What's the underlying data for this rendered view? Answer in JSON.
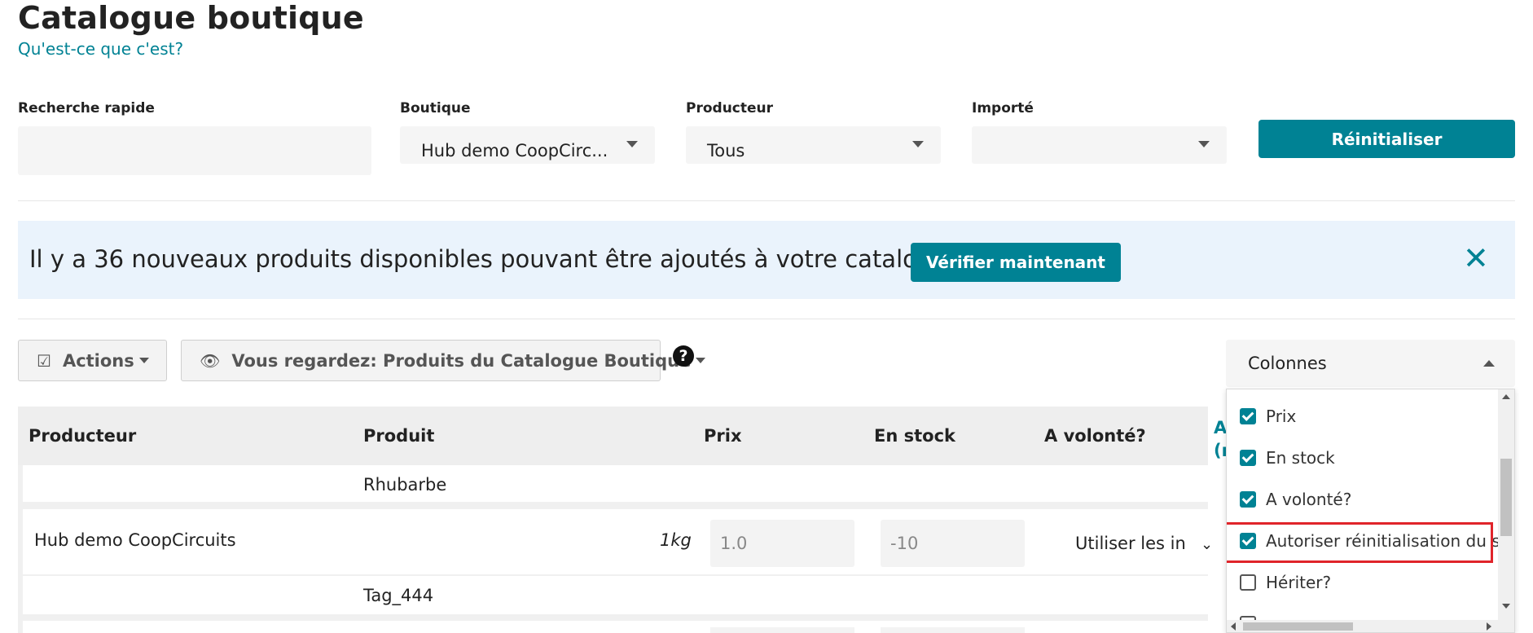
{
  "page": {
    "title": "Catalogue boutique",
    "help_link": "Qu'est-ce que c'est?"
  },
  "filters": {
    "quick_search": {
      "label": "Recherche rapide",
      "value": ""
    },
    "shop": {
      "label": "Boutique",
      "value": "Hub demo CoopCirc..."
    },
    "producer": {
      "label": "Producteur",
      "value": "Tous"
    },
    "imported": {
      "label": "Importé",
      "value": ""
    },
    "reset_label": "Réinitialiser"
  },
  "notice": {
    "text": "Il y a 36 nouveaux produits disponibles pouvant être ajoutés à votre catalogue.",
    "button": "Vérifier maintenant",
    "close": "✕"
  },
  "toolbar": {
    "actions_label": "Actions",
    "view_label": "Vous regardez: Produits du Catalogue Boutique",
    "help": "?"
  },
  "columns": {
    "label": "Colonnes",
    "options": [
      {
        "label": "Prix",
        "checked": true
      },
      {
        "label": "En stock",
        "checked": true
      },
      {
        "label": "A volonté?",
        "checked": true
      },
      {
        "label": "Autoriser réinitialisation du s",
        "checked": true
      },
      {
        "label": "Hériter?",
        "checked": false
      }
    ]
  },
  "table": {
    "headers": {
      "producer": "Producteur",
      "product": "Produit",
      "price": "Prix",
      "stock": "En stock",
      "on_demand": "A volonté?",
      "reset_link": "A (r"
    },
    "rows": [
      {
        "product": "Rhubarbe"
      },
      {
        "producer": "Hub demo CoopCircuits",
        "unit": "1kg",
        "price": "1.0",
        "stock": "-10",
        "on_demand": "Utiliser les in"
      },
      {
        "product": "Tag_444"
      }
    ]
  },
  "colors": {
    "accent": "#008294",
    "notice_bg": "#eaf3fc",
    "highlight": "#e0242a"
  }
}
